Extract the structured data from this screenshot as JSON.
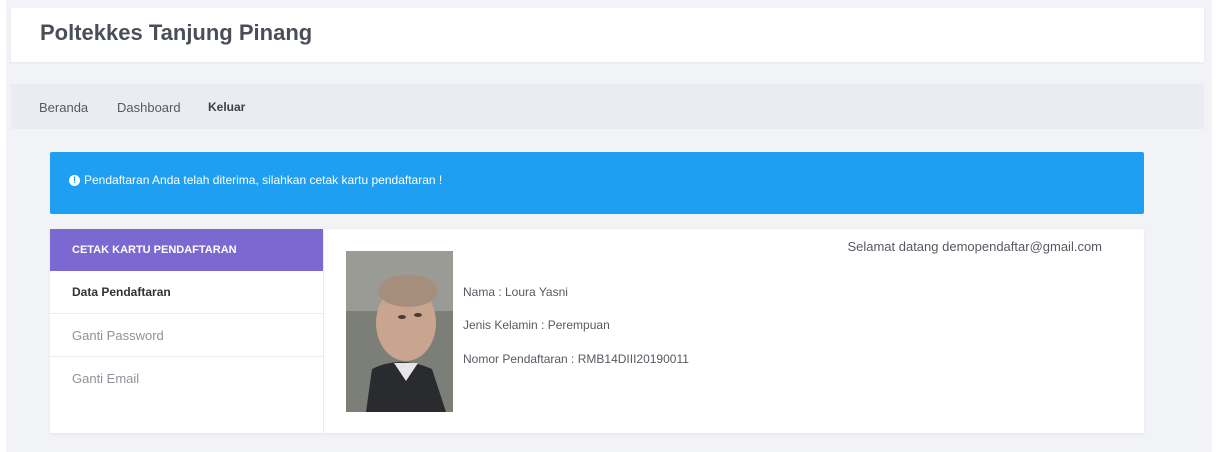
{
  "header": {
    "title": "Poltekkes Tanjung Pinang"
  },
  "nav": {
    "beranda": "Beranda",
    "dashboard": "Dashboard",
    "keluar": "Keluar"
  },
  "alert": {
    "icon": "info-circle-icon",
    "message": "Pendaftaran Anda telah diterima, silahkan cetak kartu pendaftaran !"
  },
  "sidebar": {
    "header": "CETAK KARTU PENDAFTARAN",
    "items": [
      {
        "label": "Data Pendaftaran"
      },
      {
        "label": "Ganti Password"
      },
      {
        "label": "Ganti Email"
      }
    ]
  },
  "profile": {
    "welcome": "Selamat datang demopendaftar@gmail.com",
    "nama": "Nama : Loura Yasni",
    "jenis_kelamin": "Jenis Kelamin : Perempuan",
    "nomor": "Nomor Pendaftaran : RMB14DIII20190011"
  },
  "colors": {
    "alert_bg": "#1e9ff2",
    "sidebar_header_bg": "#7b68d1"
  }
}
